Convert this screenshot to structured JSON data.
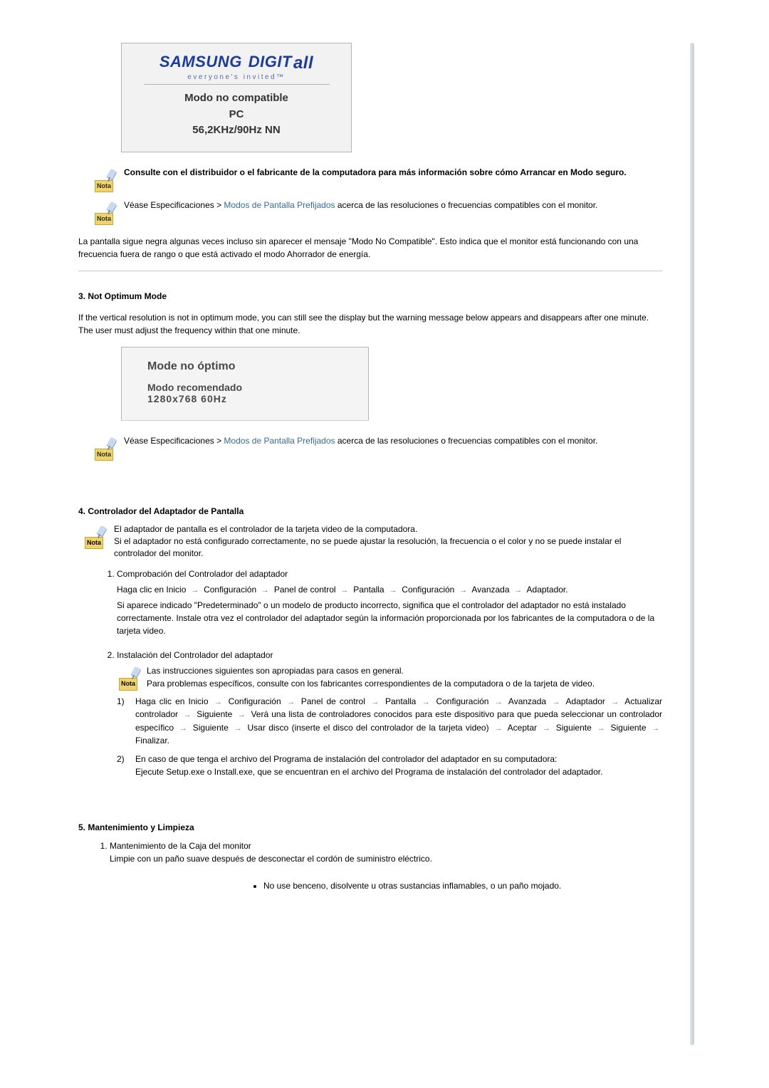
{
  "panel1": {
    "brand1": "SAMSUNG",
    "brand2": "DIGIT",
    "brand3": "all",
    "tagline": "everyone's invited™",
    "line1": "Modo no compatible",
    "line2": "PC",
    "line3": "56,2KHz/90Hz   NN"
  },
  "nota1": {
    "text": "Consulte con el distribuidor o el fabricante de la computadora para más información sobre cómo Arrancar en Modo seguro."
  },
  "nota2": {
    "pre": "Véase Especificaciones > ",
    "link": "Modos de Pantalla Prefijados",
    "post": " acerca de las resoluciones o frecuencias compatibles con el monitor."
  },
  "para1": "La pantalla sigue negra algunas veces incluso sin aparecer el mensaje \"Modo No Compatible\". Esto indica que el monitor está funcionando con una frecuencia fuera de rango o que está activado el modo Ahorrador de energía.",
  "sec3": {
    "title": "3. Not Optimum Mode",
    "desc": "If the vertical resolution is not in optimum mode, you can still see the display but the warning message below appears and disappears after one minute.\nThe user must adjust the frequency within that one minute."
  },
  "panel2": {
    "t1": "Mode no óptimo",
    "t2": "Modo recomendado",
    "t3": "1280x768     60Hz"
  },
  "nota3": {
    "pre": "Véase Especificaciones > ",
    "link": "Modos de Pantalla Prefijados",
    "post": " acerca de las resoluciones o frecuencias compatibles con el monitor."
  },
  "sec4": {
    "title": "4. Controlador del Adaptador de Pantalla",
    "nota": "El adaptador de pantalla es el controlador de la tarjeta video de la computadora.\nSi el adaptador no está configurado correctamente, no se puede ajustar la resolución, la frecuencia o el color y no se puede instalar el controlador del monitor.",
    "item1_title": "Comprobación del Controlador del adaptador",
    "item1_seq": [
      "Haga clic en Inicio",
      "Configuración",
      "Panel de control",
      "Pantalla",
      "Configuración",
      "Avanzada",
      "Adaptador."
    ],
    "item1_rest": "Si aparece indicado \"Predeterminado\" o un modelo de producto incorrecto, significa que el controlador del adaptador no está instalado correctamente. Instale otra vez el controlador del adaptador según la información proporcionada por los fabricantes de la computadora o de la tarjeta video.",
    "item2_title": "Instalación del Controlador del adaptador",
    "item2_nota": "Las instrucciones siguientes son apropiadas para casos en general.\nPara problemas específicos, consulte con los fabricantes correspondientes de la computadora o de la tarjeta de video.",
    "item2_1_seq": [
      "Haga clic en Inicio",
      "Configuración",
      "Panel de control",
      "Pantalla",
      "Configuración",
      "Avanzada",
      "Adaptador",
      "Actualizar controlador",
      "Siguiente",
      "Verá una lista de controladores conocidos para este dispositivo para que pueda seleccionar un controlador específico",
      "Siguiente",
      "Usar disco (inserte el disco del controlador de la tarjeta video)",
      "Aceptar",
      "Siguiente",
      "Siguiente",
      "Finalizar."
    ],
    "item2_2": "En caso de que tenga el archivo del Programa de instalación del controlador del adaptador en su computadora:\nEjecute Setup.exe o Install.exe, que se encuentran en el archivo del Programa de instalación del controlador del adaptador."
  },
  "sec5": {
    "title": "5. Mantenimiento y Limpieza",
    "item1_title": "Mantenimiento de la Caja del monitor",
    "item1_body": "Limpie con un paño suave después de desconectar el cordón de suministro eléctrico.",
    "bullet1": "No use benceno, disolvente u otras sustancias inflamables, o un paño mojado."
  },
  "labels": {
    "nota": "Nota"
  }
}
